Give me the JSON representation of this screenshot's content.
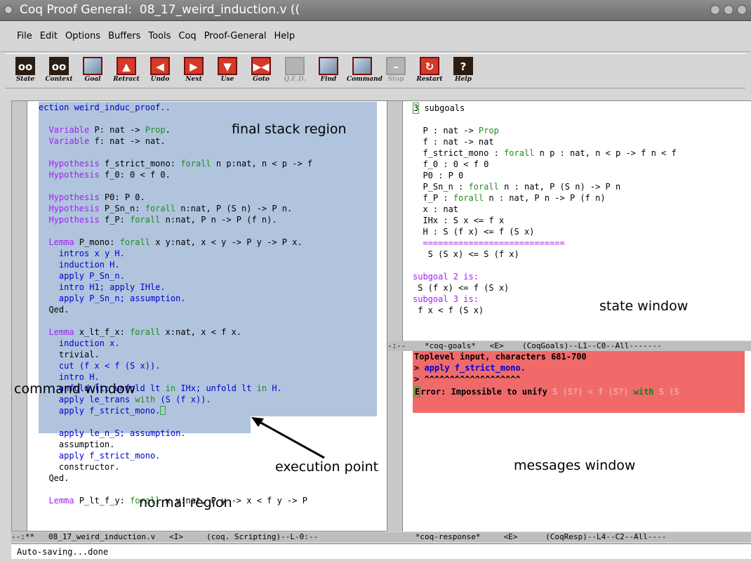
{
  "window": {
    "title": "Coq Proof General:  08_17_weird_induction.v (("
  },
  "menu": [
    "File",
    "Edit",
    "Options",
    "Buffers",
    "Tools",
    "Coq",
    "Proof-General",
    "Help"
  ],
  "toolbar": [
    {
      "label": "State",
      "icon": "state-icon",
      "enabled": true
    },
    {
      "label": "Context",
      "icon": "context-icon",
      "enabled": true
    },
    {
      "label": "Goal",
      "icon": "goal-icon",
      "enabled": true
    },
    {
      "label": "Retract",
      "icon": "retract-icon",
      "enabled": true
    },
    {
      "label": "Undo",
      "icon": "undo-icon",
      "enabled": true
    },
    {
      "label": "Next",
      "icon": "next-icon",
      "enabled": true
    },
    {
      "label": "Use",
      "icon": "use-icon",
      "enabled": true
    },
    {
      "label": "Goto",
      "icon": "goto-icon",
      "enabled": true
    },
    {
      "label": "Q.E.D.",
      "icon": "qed-icon",
      "enabled": false
    },
    {
      "label": "Find",
      "icon": "find-icon",
      "enabled": true
    },
    {
      "label": "Command",
      "icon": "command-icon",
      "enabled": true
    },
    {
      "label": "Stop",
      "icon": "stop-icon",
      "enabled": false
    },
    {
      "label": "Restart",
      "icon": "restart-icon",
      "enabled": true
    },
    {
      "label": "Help",
      "icon": "help-icon",
      "enabled": true
    }
  ],
  "script": {
    "lines": [
      "ection weird_induc_proof..",
      "",
      "  Variable P: nat -> Prop.",
      "  Variable f: nat -> nat.",
      "",
      "  Hypothesis f_strict_mono: forall n p:nat, n < p -> f",
      "  Hypothesis f_0: 0 < f 0.",
      "",
      "  Hypothesis P0: P 0.",
      "  Hypothesis P_Sn_n: forall n:nat, P (S n) -> P n.",
      "  Hypothesis f_P: forall n:nat, P n -> P (f n).",
      "",
      "  Lemma P_mono: forall x y:nat, x < y -> P y -> P x.",
      "    intros x y H.",
      "    induction H.",
      "    apply P_Sn_n.",
      "    intro H1; apply IHle.",
      "    apply P_Sn_n; assumption.",
      "  Qed.",
      "",
      "  Lemma x_lt_f_x: forall x:nat, x < f x.",
      "    induction x.",
      "    trivial.",
      "    cut (f x < f (S x)).",
      "    intro H.",
      "    unfold lt; unfold lt in IHx; unfold lt in H.",
      "    apply le_trans with (S (f x)).",
      "    apply f_strict_mono.",
      "",
      "    apply le_n_S; assumption.",
      "    assumption.",
      "    apply f_strict_mono.",
      "    constructor.",
      "  Qed.",
      "",
      "  Lemma P_lt_f_y: forall x y:nat, P y -> x < f y -> P"
    ]
  },
  "goals": {
    "count": "3",
    "header_rest": " subgoals",
    "lines": [
      "  P : nat -> Prop",
      "  f : nat -> nat",
      "  f_strict_mono : forall n p : nat, n < p -> f n < f",
      "  f_0 : 0 < f 0",
      "  P0 : P 0",
      "  P_Sn_n : forall n : nat, P (S n) -> P n",
      "  f_P : forall n : nat, P n -> P (f n)",
      "  x : nat",
      "  IHx : S x <= f x",
      "  H : S (f x) <= f (S x)",
      "  ============================",
      "   S (S x) <= S (f x)",
      "",
      "subgoal 2 is:",
      " S (f x) <= f (S x)",
      "subgoal 3 is:",
      " f x < f (S x)"
    ]
  },
  "response": {
    "line1": "Toplevel input, characters 681-700",
    "line2_prefix": "> ",
    "line2_cmd": "apply f_strict_mono.",
    "line3": "> ^^^^^^^^^^^^^^^^^^^",
    "err_first": "E",
    "err_rest": "rror: Impossible to unify ",
    "err_a": "S (S?) < f (S?)",
    "err_with": " with ",
    "err_b": "S (S"
  },
  "modelines": {
    "goals": "-:--    *coq-goals*   <E>    (CoqGoals)--L1--C0--All-------",
    "scripting": "--:**   08_17_weird_induction.v   <I>     (coq. Scripting)--L-0:--",
    "response": "      *coq-response*     <E>      (CoqResp)--L4--C2--All----"
  },
  "minibuffer": "Auto-saving...done",
  "annotations": {
    "final_stack": "final stack region",
    "command_window": "command window",
    "execution_point": "execution point",
    "normal_region": "normal region",
    "state_window": "state window",
    "messages_window": "messages window"
  },
  "colors": {
    "locked_region": "#b0c4de",
    "error_background": "#f06a6a",
    "keyword": "#a020f0",
    "tactic": "#0000cd",
    "type": "#228b22"
  }
}
